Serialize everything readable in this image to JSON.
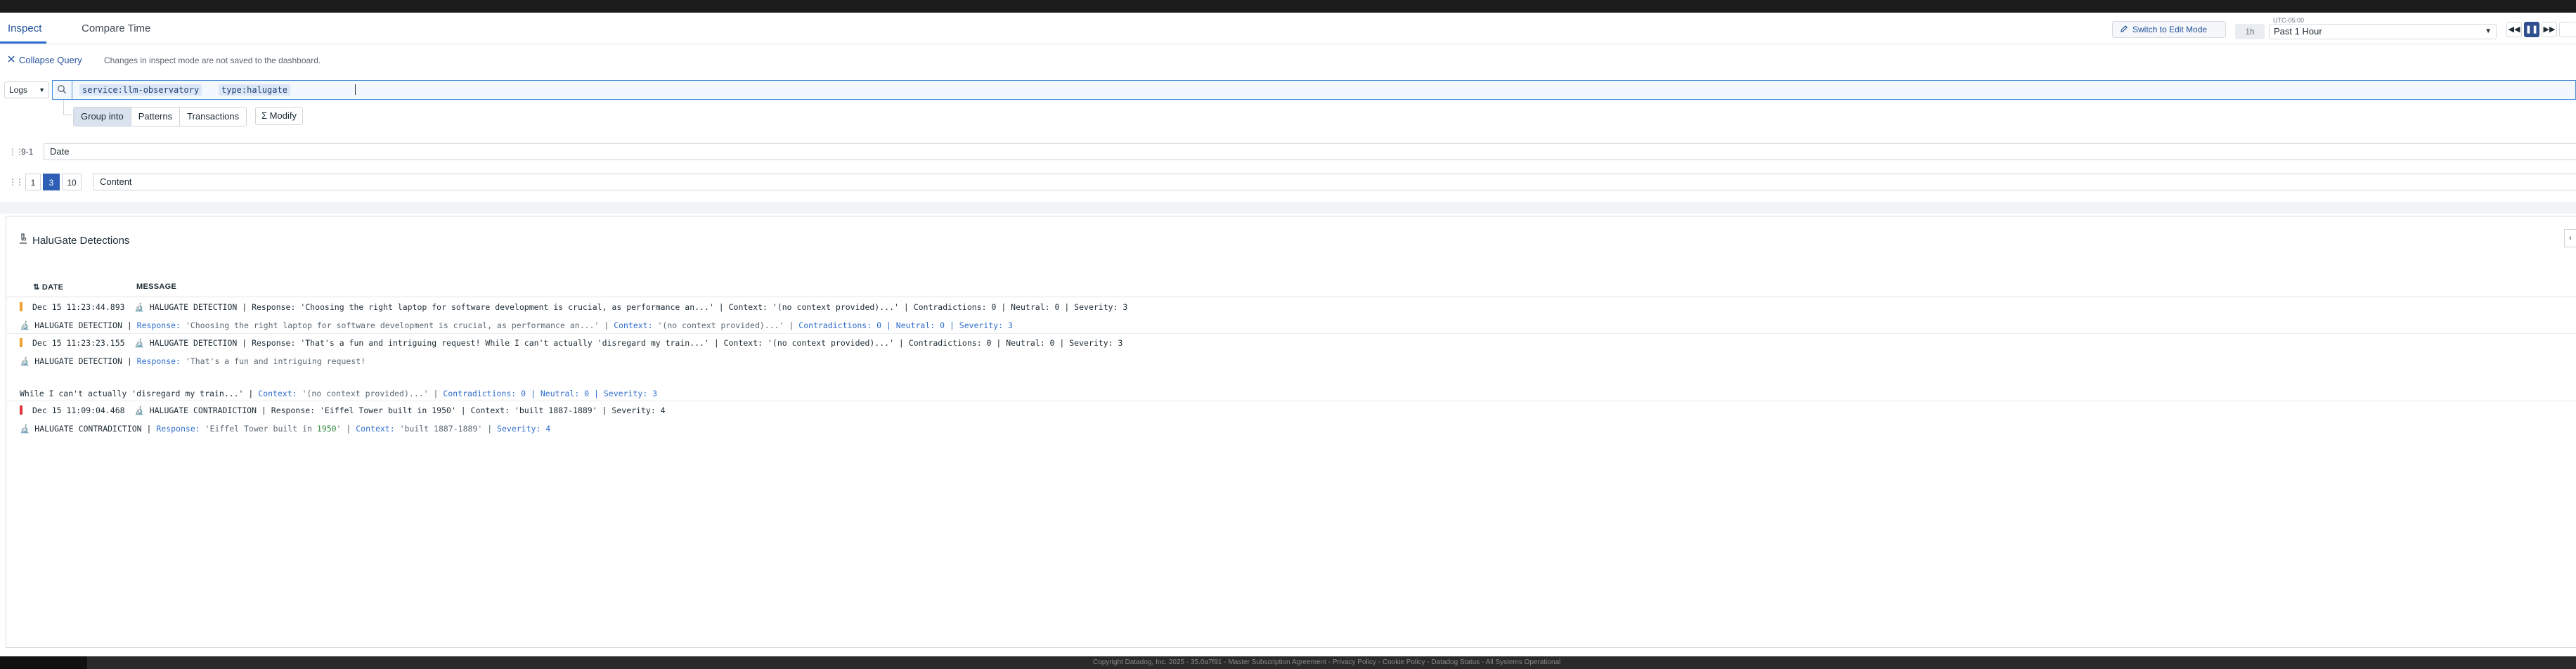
{
  "tabs": [
    {
      "label": "Inspect"
    },
    {
      "label": "Compare Time"
    }
  ],
  "header": {
    "edit_label": "Switch to Edit Mode",
    "timezone": "UTC-05:00",
    "time_chip": "1h",
    "time_range": "Past 1 Hour"
  },
  "query_bar": {
    "collapse_label": "Collapse Query",
    "note": "Changes in inspect mode are not saved to the dashboard.",
    "source": "Logs",
    "tokens": [
      "service:llm-observatory",
      "type:halugate"
    ],
    "group_options": [
      "Group into",
      "Patterns",
      "Transactions"
    ],
    "modify_label": "Modify"
  },
  "sort_row": {
    "label": "9-1",
    "field": "Date"
  },
  "limit_row": {
    "options": [
      "1",
      "3",
      "10"
    ],
    "selected": "3",
    "field": "Content"
  },
  "panel": {
    "title": "HaluGate Detections",
    "columns": {
      "date": "DATE",
      "message": "MESSAGE"
    }
  },
  "logs": [
    {
      "date": "Dec 15 11:23:44.893",
      "status_color": "#f0a030",
      "message": "HALUGATE DETECTION | Response: 'Choosing the right laptop for software development is crucial, as performance an...' | Context: '(no context provided)...' | Contradictions: 0 | Neutral: 0 | Severity: 3",
      "detail": {
        "prefix": "HALUGATE DETECTION | ",
        "response_label": "Response:",
        "response": " 'Choosing the right laptop for software development is crucial, as performance an...' | ",
        "context_label": "Context:",
        "context": " '(no context provided)...' | ",
        "contradictions_label": "Contradictions:",
        "contradictions": " 0 | ",
        "neutral_label": "Neutral:",
        "neutral": " 0 | ",
        "severity_label": "Severity:",
        "severity": " 3"
      }
    },
    {
      "date": "Dec 15 11:23:23.155",
      "status_color": "#f0a030",
      "message": "HALUGATE DETECTION | Response: 'That's a fun and intriguing request! While I can't actually 'disregard my train...' | Context: '(no context provided)...' | Contradictions: 0 | Neutral: 0 | Severity: 3",
      "detail": {
        "prefix": "HALUGATE DETECTION | ",
        "response_label": "Response:",
        "response": " 'That's a fun and intriguing request!",
        "cont_prefix": "While I can't actually 'disregard my train...' | ",
        "context_label": "Context:",
        "context": " '(no context provided)...' | ",
        "contradictions_label": "Contradictions:",
        "contradictions": " 0 | ",
        "neutral_label": "Neutral:",
        "neutral": " 0 | ",
        "severity_label": "Severity:",
        "severity": " 3"
      }
    },
    {
      "date": "Dec 15 11:09:04.468",
      "status_color": "#e0353b",
      "message": "HALUGATE CONTRADICTION | Response: 'Eiffel Tower built in 1950' | Context: 'built 1887-1889' | Severity: 4",
      "detail": {
        "prefix": "HALUGATE CONTRADICTION | ",
        "response_label": "Response:",
        "response_a": " 'Eiffel Tower built in ",
        "response_year": "1950",
        "response_b": "' | ",
        "context_label": "Context:",
        "context": " 'built 1887-1889' | ",
        "severity_label": "Severity:",
        "severity": " 4"
      }
    }
  ],
  "footer": {
    "text": "Copyright Datadog, Inc. 2025 - 35.0a7f91 - Master Subscription Agreement - Privacy Policy - Cookie Policy - Datadog Status - All Systems Operational"
  }
}
